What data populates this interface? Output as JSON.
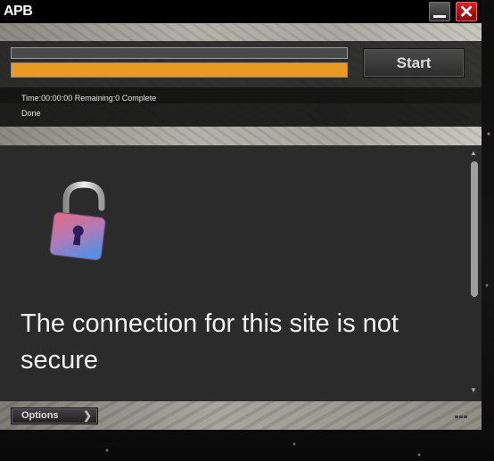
{
  "window": {
    "title": "APB"
  },
  "progress": {
    "fraction": 1.0,
    "fill_color": "#e89a22"
  },
  "toolbar": {
    "start_label": "Start"
  },
  "status": {
    "summary": "Time:00:00:00  Remaining:0  Complete",
    "state": "Done"
  },
  "content": {
    "heading": "The connection for this site is not secure",
    "icon": "unlocked-padlock-icon"
  },
  "footer": {
    "options_label": "Options"
  },
  "colors": {
    "accent": "#e89a22",
    "close": "#cc1111"
  }
}
